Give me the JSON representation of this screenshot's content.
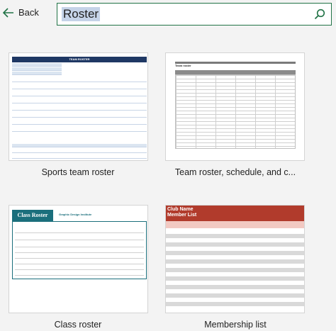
{
  "header": {
    "back_label": "Back",
    "search_value": "Roster"
  },
  "templates": [
    {
      "caption": "Sports team roster",
      "thumb_title": "TEAM ROSTER"
    },
    {
      "caption": "Team roster, schedule, and c...",
      "thumb_title": "Team roster"
    },
    {
      "caption": "Class roster",
      "thumb_title": "Class Roster",
      "thumb_subtitle": "Graphic Design Institute"
    },
    {
      "caption": "Membership list",
      "thumb_title": "Club Name",
      "thumb_subtitle": "Member List"
    }
  ],
  "colors": {
    "accent": "#217346",
    "navy": "#1f3864",
    "teal": "#1b6f7c",
    "red": "#b13b2c"
  }
}
